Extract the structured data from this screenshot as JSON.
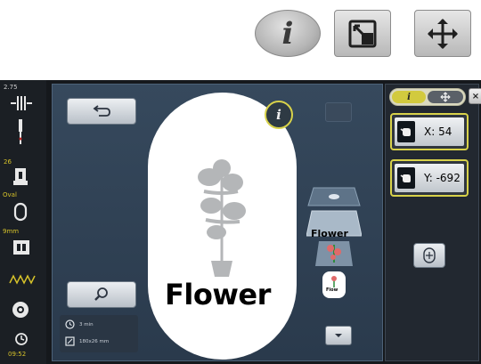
{
  "top_icons": [
    {
      "name": "info-icon",
      "glyph": "i"
    },
    {
      "name": "resize-icon"
    },
    {
      "name": "move-icon"
    }
  ],
  "status_bar": {
    "top_value": "2.75",
    "tension_icon": "thread-tension-icon",
    "needle_icon": "needle-icon",
    "presser_foot_value": "26",
    "presser_foot_icon": "presser-foot-icon",
    "hoop_label": "Oval",
    "hoop_icon": "hoop-icon",
    "stitch_plate_label": "9mm",
    "stitch_plate_icon": "stitch-plate-icon",
    "thread_icon": "feed-dog-icon",
    "settings_icon": "bobbin-icon",
    "clock_icon": "clock-icon",
    "time": "09:52"
  },
  "canvas": {
    "back_button_icon": "back-arrow-icon",
    "zoom_button_icon": "zoom-icon",
    "design_text": "Flower",
    "info_label": "i",
    "stitch_time": "3 min",
    "design_size": "180x26 mm",
    "layer_stack_label": "Flower",
    "layer_stack_mini_label": "Flow"
  },
  "right_panel": {
    "tab_info_label": "i",
    "tab_move_icon": "move-icon",
    "close_label": "×",
    "x_label": "X: 54",
    "y_label": "Y: -692",
    "center_icon": "center-icon"
  },
  "colors": {
    "accent_yellow": "#d8d24a",
    "screen_bg": "#2c3c4e",
    "panel_bg": "#222830",
    "status_yellow": "#d6c22a"
  }
}
